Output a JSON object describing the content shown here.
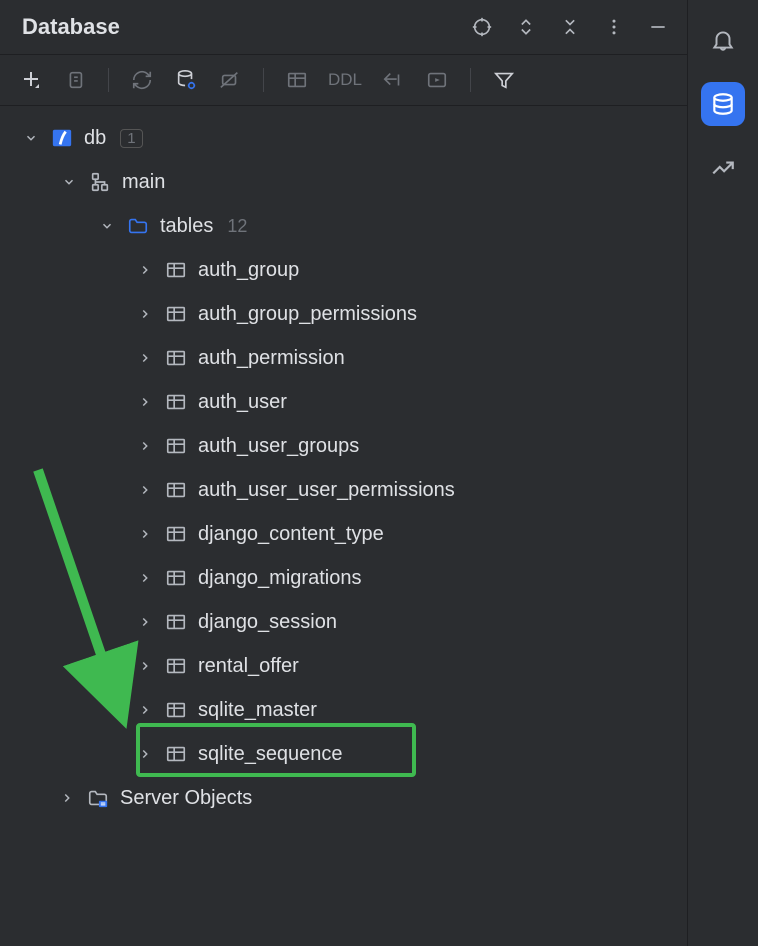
{
  "header": {
    "title": "Database"
  },
  "toolbar": {
    "ddl_label": "DDL"
  },
  "tree": {
    "db_label": "db",
    "db_badge": "1",
    "schema_label": "main",
    "tables_label": "tables",
    "tables_count": "12",
    "tables": [
      "auth_group",
      "auth_group_permissions",
      "auth_permission",
      "auth_user",
      "auth_user_groups",
      "auth_user_user_permissions",
      "django_content_type",
      "django_migrations",
      "django_session",
      "rental_offer",
      "sqlite_master",
      "sqlite_sequence"
    ],
    "server_objects_label": "Server Objects"
  }
}
